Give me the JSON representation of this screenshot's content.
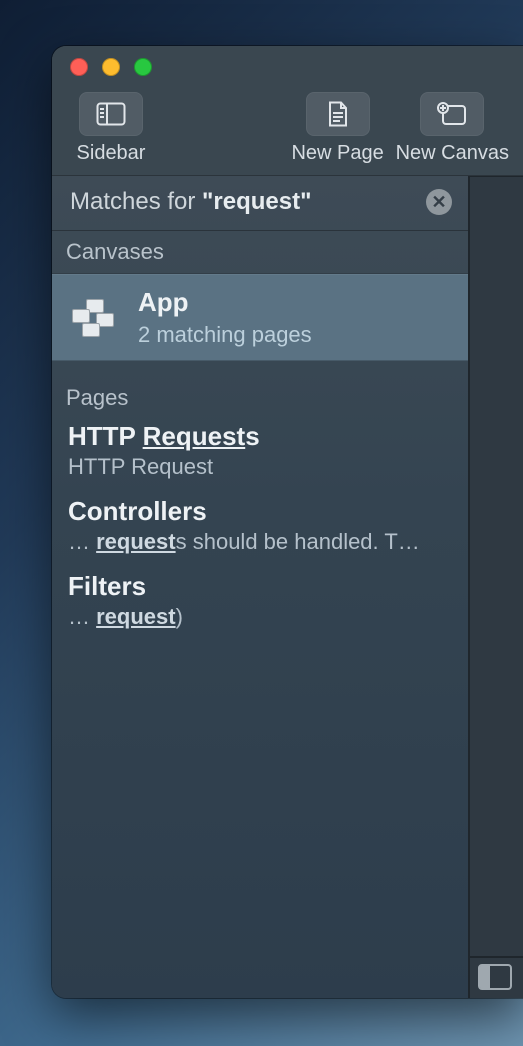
{
  "toolbar": {
    "sidebar_label": "Sidebar",
    "new_page_label": "New Page",
    "new_canvas_label": "New Canvas"
  },
  "search": {
    "prefix": "Matches for ",
    "quoted": "\"request\"",
    "clear_glyph": "✕"
  },
  "sections": {
    "canvases_label": "Canvases",
    "pages_label": "Pages"
  },
  "canvas": {
    "title": "App",
    "subtitle": "2 matching pages"
  },
  "pages": [
    {
      "title_pre": "HTTP ",
      "title_hl": "Request",
      "title_post": "s",
      "sub_pre": "HTTP Request",
      "sub_hl": "",
      "sub_post": ""
    },
    {
      "title_pre": "Controllers",
      "title_hl": "",
      "title_post": "",
      "sub_pre": "… ",
      "sub_hl": "request",
      "sub_post": "s should be handled. T…"
    },
    {
      "title_pre": "Filters",
      "title_hl": "",
      "title_post": "",
      "sub_pre": "… ",
      "sub_hl": "request",
      "sub_post": ")"
    }
  ]
}
